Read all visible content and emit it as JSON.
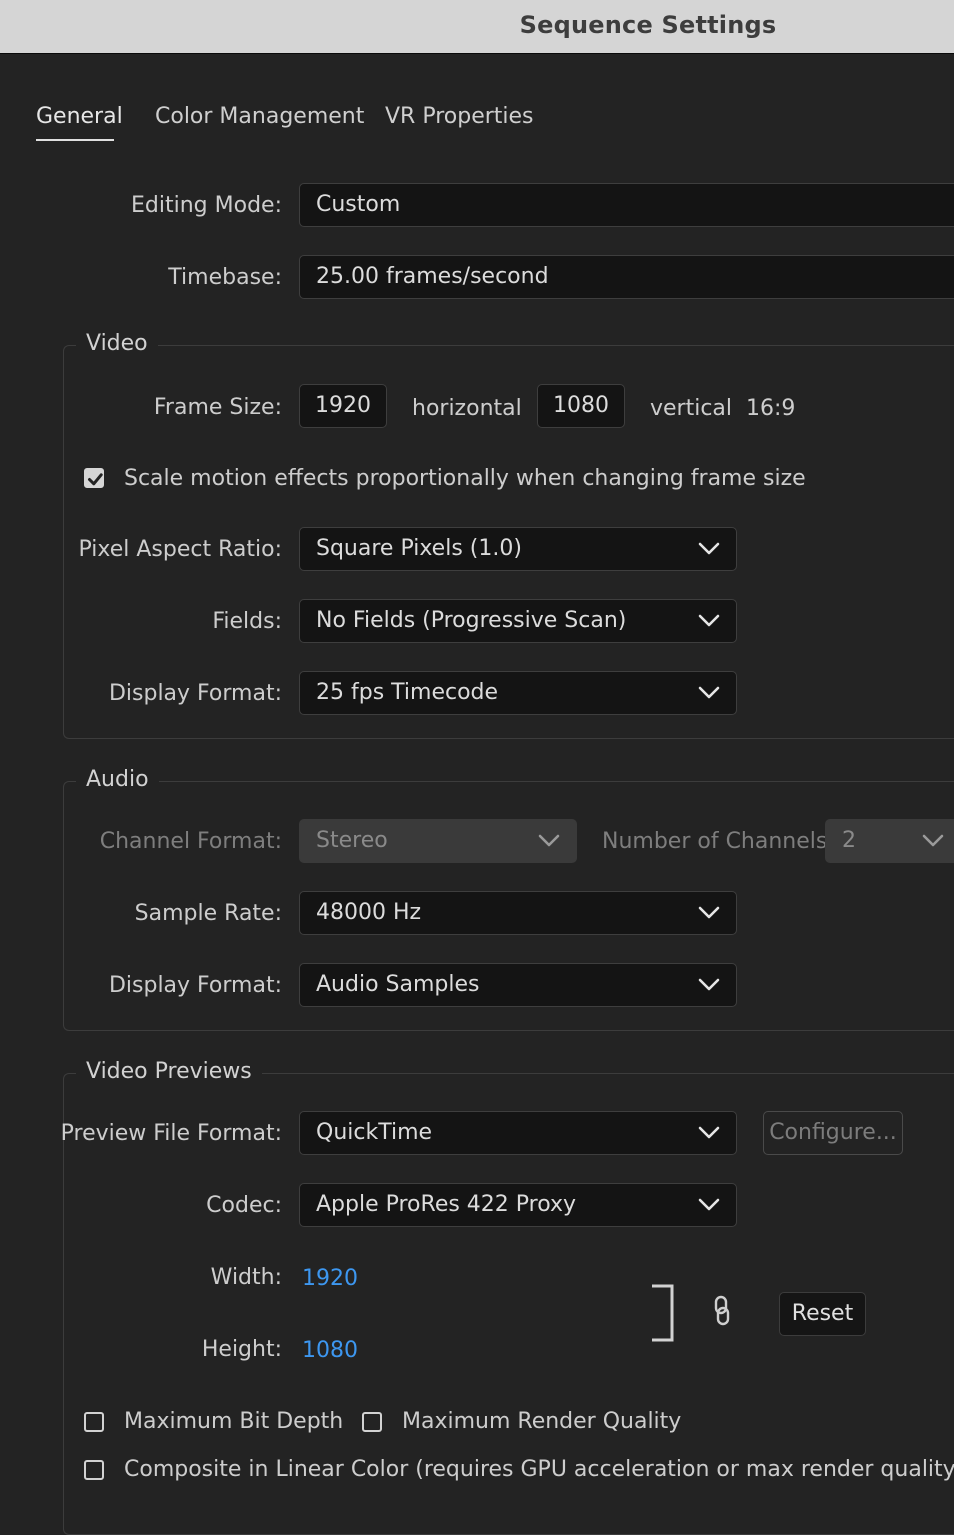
{
  "window": {
    "title": "Sequence Settings"
  },
  "tabs": [
    {
      "label": "General"
    },
    {
      "label": "Color Management"
    },
    {
      "label": "VR Properties"
    }
  ],
  "general": {
    "editing_mode": {
      "label": "Editing Mode:",
      "value": "Custom"
    },
    "timebase": {
      "label": "Timebase:",
      "value": "25.00  frames/second"
    }
  },
  "video": {
    "legend": "Video",
    "frame_size": {
      "label": "Frame Size:",
      "width": "1920",
      "horizontal": "horizontal",
      "height": "1080",
      "vertical": "vertical",
      "aspect": "16:9"
    },
    "scale_motion": {
      "label": "Scale motion effects proportionally when changing frame size",
      "checked": true
    },
    "pixel_aspect": {
      "label": "Pixel Aspect Ratio:",
      "value": "Square Pixels (1.0)"
    },
    "fields": {
      "label": "Fields:",
      "value": "No Fields (Progressive Scan)"
    },
    "display_format": {
      "label": "Display Format:",
      "value": "25 fps Timecode"
    }
  },
  "audio": {
    "legend": "Audio",
    "channel_format": {
      "label": "Channel Format:",
      "value": "Stereo"
    },
    "num_channels": {
      "label": "Number of Channels:",
      "value": "2"
    },
    "sample_rate": {
      "label": "Sample Rate:",
      "value": "48000 Hz"
    },
    "display_format": {
      "label": "Display Format:",
      "value": "Audio Samples"
    }
  },
  "previews": {
    "legend": "Video Previews",
    "file_format": {
      "label": "Preview File Format:",
      "value": "QuickTime"
    },
    "configure": "Configure...",
    "codec": {
      "label": "Codec:",
      "value": "Apple ProRes 422 Proxy"
    },
    "width": {
      "label": "Width:",
      "value": "1920"
    },
    "height": {
      "label": "Height:",
      "value": "1080"
    },
    "reset": "Reset"
  },
  "options": {
    "max_bit_depth": {
      "label": "Maximum Bit Depth",
      "checked": false
    },
    "max_render_quality": {
      "label": "Maximum Render Quality",
      "checked": false
    },
    "linear_color": {
      "label": "Composite in Linear Color (requires GPU acceleration or max render quality)",
      "checked": false
    }
  },
  "colors": {
    "accent_blue": "#3d97f0",
    "background": "#232323",
    "field_bg": "#141414"
  },
  "icons": [
    "chevron-down-icon",
    "checkmark-icon",
    "link-icon",
    "bracket-icon"
  ]
}
